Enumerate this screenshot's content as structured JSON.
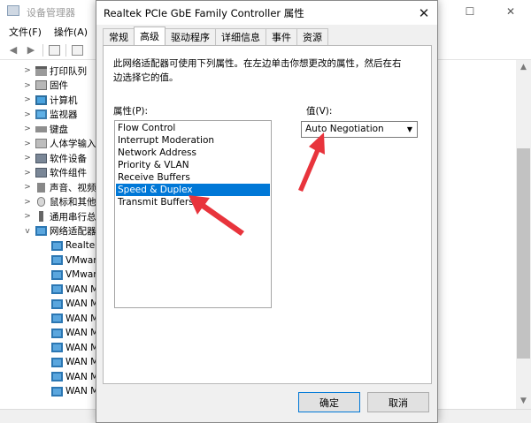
{
  "device_manager": {
    "title": "设备管理器",
    "window_buttons": {
      "minimize": "—",
      "maximize": "☐",
      "close": "✕"
    },
    "menu": [
      "文件(F)",
      "操作(A)"
    ],
    "tree": [
      {
        "expander": ">",
        "icon": "printer-icon",
        "label": "打印队列"
      },
      {
        "expander": ">",
        "icon": "firmware-icon",
        "label": "固件"
      },
      {
        "expander": ">",
        "icon": "computer-icon",
        "label": "计算机"
      },
      {
        "expander": ">",
        "icon": "monitor-icon",
        "label": "监视器"
      },
      {
        "expander": ">",
        "icon": "keyboard-icon",
        "label": "键盘"
      },
      {
        "expander": ">",
        "icon": "hid-icon",
        "label": "人体学输入设备"
      },
      {
        "expander": ">",
        "icon": "software-device-icon",
        "label": "软件设备"
      },
      {
        "expander": ">",
        "icon": "software-component-icon",
        "label": "软件组件"
      },
      {
        "expander": ">",
        "icon": "sound-icon",
        "label": "声音、视频和游戏控制器"
      },
      {
        "expander": ">",
        "icon": "mouse-icon",
        "label": "鼠标和其他指针设备"
      },
      {
        "expander": ">",
        "icon": "usb-icon",
        "label": "通用串行总线控制器"
      },
      {
        "expander": "v",
        "icon": "network-adapter-icon",
        "label": "网络适配器"
      },
      {
        "expander": "",
        "icon": "network-adapter-icon",
        "label": "Realtek PCIe GbE Family Controller"
      },
      {
        "expander": "",
        "icon": "network-adapter-icon",
        "label": "VMware Virtual Ethernet Adapter"
      },
      {
        "expander": "",
        "icon": "network-adapter-icon",
        "label": "VMware Virtual Ethernet Adapter"
      },
      {
        "expander": "",
        "icon": "network-adapter-icon",
        "label": "WAN Miniport"
      },
      {
        "expander": "",
        "icon": "network-adapter-icon",
        "label": "WAN Miniport"
      },
      {
        "expander": "",
        "icon": "network-adapter-icon",
        "label": "WAN Miniport"
      },
      {
        "expander": "",
        "icon": "network-adapter-icon",
        "label": "WAN Miniport"
      },
      {
        "expander": "",
        "icon": "network-adapter-icon",
        "label": "WAN Miniport"
      },
      {
        "expander": "",
        "icon": "network-adapter-icon",
        "label": "WAN Miniport"
      },
      {
        "expander": "",
        "icon": "network-adapter-icon",
        "label": "WAN Miniport"
      },
      {
        "expander": "",
        "icon": "network-adapter-icon",
        "label": "WAN Miniport"
      }
    ]
  },
  "dialog": {
    "title": "Realtek PCIe GbE Family Controller 属性",
    "close_glyph": "✕",
    "tabs": [
      "常规",
      "高级",
      "驱动程序",
      "详细信息",
      "事件",
      "资源"
    ],
    "active_tab": "高级",
    "description": "此网络适配器可使用下列属性。在左边单击你想更改的属性，然后在右边选择它的值。",
    "property_label": "属性(P):",
    "value_label": "值(V):",
    "properties": [
      "Flow Control",
      "Interrupt Moderation",
      "Network Address",
      "Priority & VLAN",
      "Receive Buffers",
      "Speed & Duplex",
      "Transmit Buffers"
    ],
    "selected_property": "Speed & Duplex",
    "value": "Auto Negotiation",
    "ok_label": "确定",
    "cancel_label": "取消"
  },
  "colors": {
    "selection": "#0078d7",
    "annotation_arrow": "#e8343c"
  }
}
